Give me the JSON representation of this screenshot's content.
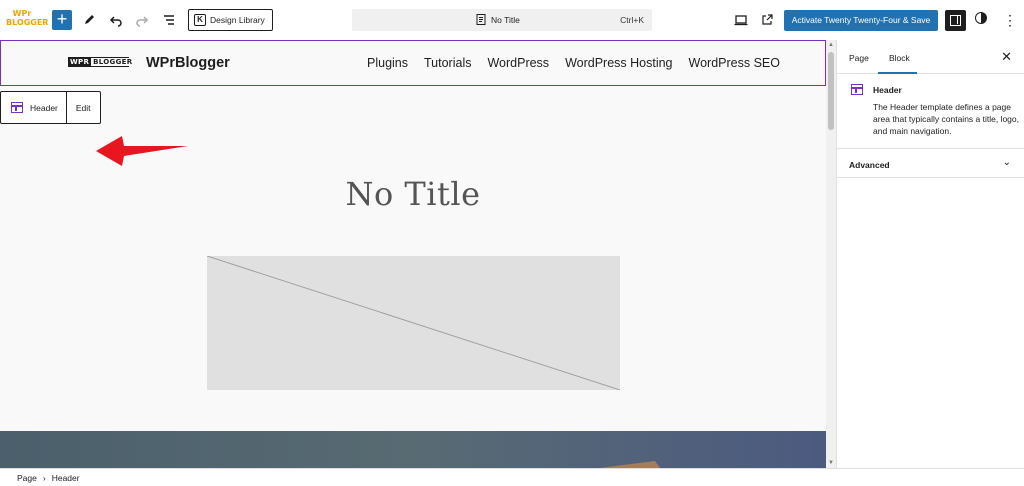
{
  "app": {
    "logo_text_top": "WPr",
    "logo_text_bottom": "BLOGGER"
  },
  "toolbar": {
    "add_label": "+",
    "design_library_label": "Design Library",
    "document_title": "No Title",
    "shortcut": "Ctrl+K",
    "activate_label": "Activate Twenty Twenty-Four & Save",
    "kebab_label": "⋮"
  },
  "site_header": {
    "logo_wpr": "WPR",
    "logo_blogger": "BLOGGER",
    "site_name": "WPrBlogger",
    "nav": [
      "Plugins",
      "Tutorials",
      "WordPress",
      "WordPress Hosting",
      "WordPress SEO"
    ]
  },
  "block_toolbar": {
    "block_name": "Header",
    "edit_label": "Edit"
  },
  "post": {
    "title": "No Title"
  },
  "sidebar": {
    "tabs": [
      "Page",
      "Block"
    ],
    "active_tab": "Block",
    "close_label": "✕",
    "block_title": "Header",
    "block_description": "The Header template defines a page area that typically contains a title, logo, and main navigation.",
    "advanced_label": "Advanced"
  },
  "breadcrumb": {
    "items": [
      "Page",
      "Header"
    ],
    "separator": "›"
  },
  "colors": {
    "accent": "#2271b1",
    "template_purple": "#7b2fc7",
    "annotation_arrow": "#e8161e"
  }
}
